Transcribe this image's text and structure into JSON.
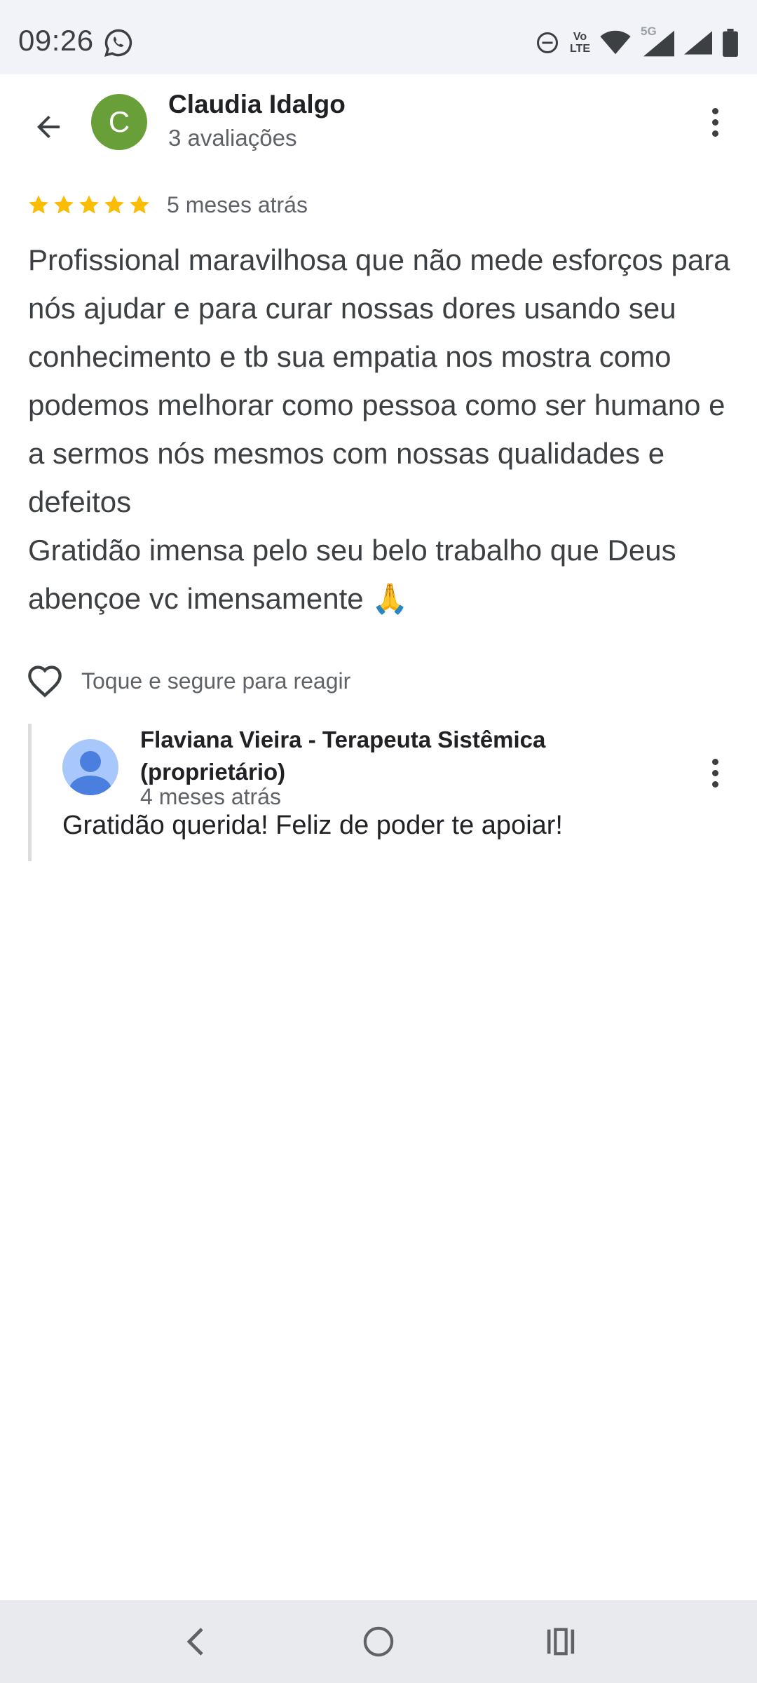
{
  "status_bar": {
    "time": "09:26",
    "icons": [
      "whatsapp-icon",
      "dnd-icon",
      "volte-icon",
      "wifi-icon",
      "signal-5g-icon",
      "signal-icon",
      "battery-icon"
    ],
    "volte_line1": "Vo",
    "volte_line2": "LTE",
    "network_label": "5G"
  },
  "header": {
    "back_icon": "arrow-back-icon",
    "avatar_letter": "C",
    "avatar_color": "#689f38",
    "reviewer_name": "Claudia Idalgo",
    "review_count": "3 avaliações",
    "menu_icon": "more-vert-icon"
  },
  "review": {
    "stars": 5,
    "star_color": "#fbbc04",
    "time": "5 meses atrás",
    "text": "Profissional maravilhosa que não mede esforços para nós ajudar e para curar nossas dores usando seu conhecimento e tb sua empatia nos mostra como podemos melhorar como pessoa como ser humano e a sermos nós mesmos com nossas qualidades e defeitos\nGratidão imensa pelo seu belo trabalho que Deus abençoe vc imensamente 🙏"
  },
  "react": {
    "icon": "heart-outline-icon",
    "label": "Toque e segure para reagir"
  },
  "owner_reply": {
    "avatar_icon": "person-avatar-icon",
    "name": "Flaviana Vieira - Terapeuta Sistêmica (proprietário)",
    "time": "4 meses atrás",
    "text": "Gratidão querida! Feliz de poder te apoiar!",
    "menu_icon": "more-vert-icon"
  },
  "nav_bar": {
    "buttons": [
      "nav-back-icon",
      "nav-home-icon",
      "nav-recents-icon"
    ]
  }
}
